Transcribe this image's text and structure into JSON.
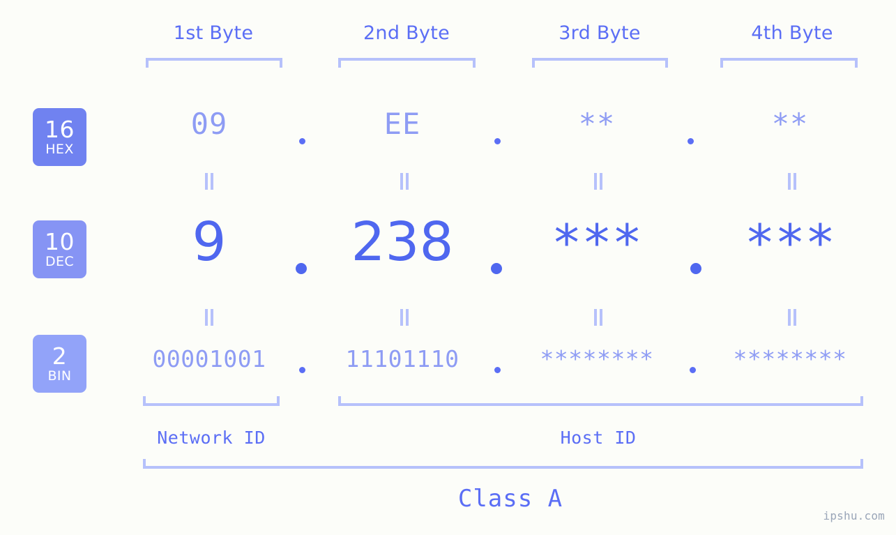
{
  "page": {
    "background_color": "#fcfdf9",
    "accent_color": "#5b6ef5",
    "accent_light_color": "#8e9cf4",
    "bracket_color": "#b6c1fb",
    "watermark": "ipshu.com"
  },
  "byte_headers": [
    {
      "label": "1st Byte"
    },
    {
      "label": "2nd Byte"
    },
    {
      "label": "3rd Byte"
    },
    {
      "label": "4th Byte"
    }
  ],
  "bases": [
    {
      "number": "16",
      "abbr": "HEX",
      "color": "#7082f0"
    },
    {
      "number": "10",
      "abbr": "DEC",
      "color": "#8694f4"
    },
    {
      "number": "2",
      "abbr": "BIN",
      "color": "#92a3f9"
    }
  ],
  "rows": {
    "hex": {
      "base_number": "16",
      "base_abbr": "HEX",
      "values": [
        "09",
        "EE",
        "**",
        "**"
      ],
      "separator": "."
    },
    "dec": {
      "base_number": "10",
      "base_abbr": "DEC",
      "values": [
        "9",
        "238",
        "***",
        "***"
      ],
      "separator": "."
    },
    "bin": {
      "base_number": "2",
      "base_abbr": "BIN",
      "values": [
        "00001001",
        "11101110",
        "********",
        "********"
      ],
      "separator": "."
    }
  },
  "equals_marks": {
    "glyph": "=",
    "count_per_gap": 4
  },
  "footer": {
    "network_id_label": "Network ID",
    "host_id_label": "Host ID",
    "class_label": "Class A"
  }
}
